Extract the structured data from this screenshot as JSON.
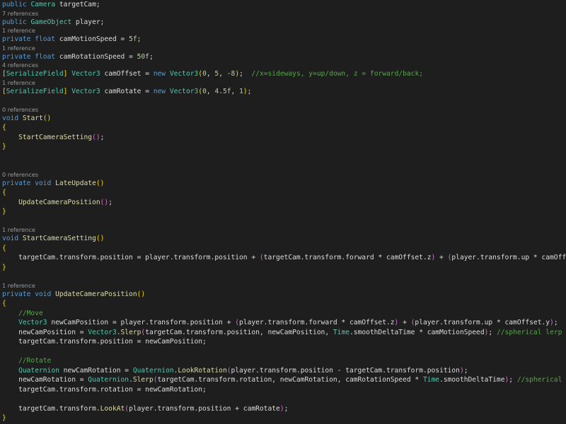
{
  "editor": {
    "language": "csharp",
    "colors": {
      "background": "#1e1e1e",
      "keyword": "#569cd6",
      "type": "#4ec9b0",
      "method": "#dcdcaa",
      "number": "#b5cea8",
      "comment": "#57a64a",
      "codelens": "#999999"
    },
    "lines": [
      {
        "kind": "code",
        "tokens": [
          {
            "t": "public ",
            "c": "kw"
          },
          {
            "t": "Camera ",
            "c": "type"
          },
          {
            "t": "targetCam;"
          }
        ]
      },
      {
        "kind": "lens",
        "text": "7 references"
      },
      {
        "kind": "code",
        "tokens": [
          {
            "t": "public ",
            "c": "kw"
          },
          {
            "t": "GameObject ",
            "c": "type"
          },
          {
            "t": "player;"
          }
        ]
      },
      {
        "kind": "lens",
        "text": "1 reference"
      },
      {
        "kind": "code",
        "tokens": [
          {
            "t": "private float ",
            "c": "kw"
          },
          {
            "t": "camMotionSpeed = "
          },
          {
            "t": "5f",
            "c": "num"
          },
          {
            "t": ";"
          }
        ]
      },
      {
        "kind": "lens",
        "text": "1 reference"
      },
      {
        "kind": "code",
        "tokens": [
          {
            "t": "private float ",
            "c": "kw"
          },
          {
            "t": "camRotationSpeed = "
          },
          {
            "t": "50f",
            "c": "num"
          },
          {
            "t": ";"
          }
        ]
      },
      {
        "kind": "lens",
        "text": "4 references"
      },
      {
        "kind": "code",
        "tokens": [
          {
            "t": "[",
            "c": "b1"
          },
          {
            "t": "SerializeField",
            "c": "attr"
          },
          {
            "t": "] ",
            "c": "b1"
          },
          {
            "t": "Vector3 ",
            "c": "type"
          },
          {
            "t": "camOffset = "
          },
          {
            "t": "new ",
            "c": "kw"
          },
          {
            "t": "Vector3",
            "c": "type"
          },
          {
            "t": "(",
            "c": "b1"
          },
          {
            "t": "0",
            "c": "num"
          },
          {
            "t": ", "
          },
          {
            "t": "5",
            "c": "num"
          },
          {
            "t": ", -"
          },
          {
            "t": "8",
            "c": "num"
          },
          {
            "t": ")",
            "c": "b1"
          },
          {
            "t": ";  "
          },
          {
            "t": "//x=sideways, y=up/down, z = forward/back;",
            "c": "cmt"
          }
        ]
      },
      {
        "kind": "lens",
        "text": "1 reference"
      },
      {
        "kind": "code",
        "tokens": [
          {
            "t": "[",
            "c": "b1"
          },
          {
            "t": "SerializeField",
            "c": "attr"
          },
          {
            "t": "] ",
            "c": "b1"
          },
          {
            "t": "Vector3 ",
            "c": "type"
          },
          {
            "t": "camRotate = "
          },
          {
            "t": "new ",
            "c": "kw"
          },
          {
            "t": "Vector3",
            "c": "type"
          },
          {
            "t": "(",
            "c": "b1"
          },
          {
            "t": "0",
            "c": "num"
          },
          {
            "t": ", "
          },
          {
            "t": "4.5f",
            "c": "num"
          },
          {
            "t": ", "
          },
          {
            "t": "1",
            "c": "num"
          },
          {
            "t": ")",
            "c": "b1"
          },
          {
            "t": ";"
          }
        ]
      },
      {
        "kind": "gap"
      },
      {
        "kind": "lens",
        "text": "0 references"
      },
      {
        "kind": "code",
        "tokens": [
          {
            "t": "void ",
            "c": "kw"
          },
          {
            "t": "Start",
            "c": "mth"
          },
          {
            "t": "()",
            "c": "b1"
          }
        ]
      },
      {
        "kind": "code",
        "tokens": [
          {
            "t": "{",
            "c": "b1"
          }
        ]
      },
      {
        "kind": "code",
        "tokens": [
          {
            "t": "    "
          },
          {
            "t": "StartCameraSetting",
            "c": "mth"
          },
          {
            "t": "()",
            "c": "b2"
          },
          {
            "t": ";"
          }
        ]
      },
      {
        "kind": "code",
        "tokens": [
          {
            "t": "}",
            "c": "b1"
          }
        ]
      },
      {
        "kind": "gap"
      },
      {
        "kind": "gap"
      },
      {
        "kind": "lens",
        "text": "0 references"
      },
      {
        "kind": "code",
        "tokens": [
          {
            "t": "private void ",
            "c": "kw"
          },
          {
            "t": "LateUpdate",
            "c": "mth"
          },
          {
            "t": "()",
            "c": "b1"
          }
        ]
      },
      {
        "kind": "code",
        "tokens": [
          {
            "t": "{",
            "c": "b1"
          }
        ]
      },
      {
        "kind": "code",
        "tokens": [
          {
            "t": "    "
          },
          {
            "t": "UpdateCameraPosition",
            "c": "mth"
          },
          {
            "t": "()",
            "c": "b2"
          },
          {
            "t": ";"
          }
        ]
      },
      {
        "kind": "code",
        "tokens": [
          {
            "t": "}",
            "c": "b1"
          }
        ]
      },
      {
        "kind": "gap"
      },
      {
        "kind": "lens",
        "text": "1 reference"
      },
      {
        "kind": "code",
        "tokens": [
          {
            "t": "void ",
            "c": "kw"
          },
          {
            "t": "StartCameraSetting",
            "c": "mth"
          },
          {
            "t": "()",
            "c": "b1"
          }
        ]
      },
      {
        "kind": "code",
        "tokens": [
          {
            "t": "{",
            "c": "b1"
          }
        ]
      },
      {
        "kind": "code",
        "tokens": [
          {
            "t": "    targetCam.transform.position = player.transform.position + "
          },
          {
            "t": "(",
            "c": "b2"
          },
          {
            "t": "targetCam.transform.forward * camOffset.z"
          },
          {
            "t": ")",
            "c": "b2"
          },
          {
            "t": " + "
          },
          {
            "t": "(",
            "c": "b2"
          },
          {
            "t": "player.transform.up * camOffset.y"
          },
          {
            "t": ")",
            "c": "b2"
          },
          {
            "t": ";"
          }
        ]
      },
      {
        "kind": "code",
        "tokens": [
          {
            "t": "}",
            "c": "b1"
          }
        ]
      },
      {
        "kind": "gap"
      },
      {
        "kind": "lens",
        "text": "1 reference"
      },
      {
        "kind": "code",
        "tokens": [
          {
            "t": "private void ",
            "c": "kw"
          },
          {
            "t": "UpdateCameraPosition",
            "c": "mth"
          },
          {
            "t": "()",
            "c": "b1"
          }
        ]
      },
      {
        "kind": "code",
        "tokens": [
          {
            "t": "{",
            "c": "b1"
          }
        ]
      },
      {
        "kind": "code",
        "tokens": [
          {
            "t": "    "
          },
          {
            "t": "//Move",
            "c": "cmt"
          }
        ]
      },
      {
        "kind": "code",
        "tokens": [
          {
            "t": "    "
          },
          {
            "t": "Vector3 ",
            "c": "type"
          },
          {
            "t": "newCamPosition = player.transform.position + "
          },
          {
            "t": "(",
            "c": "b2"
          },
          {
            "t": "player.transform.forward * camOffset.z"
          },
          {
            "t": ")",
            "c": "b2"
          },
          {
            "t": " + "
          },
          {
            "t": "(",
            "c": "b2"
          },
          {
            "t": "player.transform.up * camOffset.y"
          },
          {
            "t": ")",
            "c": "b2"
          },
          {
            "t": ";"
          }
        ]
      },
      {
        "kind": "code",
        "tokens": [
          {
            "t": "    newCamPosition = "
          },
          {
            "t": "Vector3",
            "c": "type"
          },
          {
            "t": "."
          },
          {
            "t": "Slerp",
            "c": "mth"
          },
          {
            "t": "(",
            "c": "b2"
          },
          {
            "t": "targetCam.transform.position, newCamPosition, "
          },
          {
            "t": "Time",
            "c": "type"
          },
          {
            "t": ".smoothDeltaTime * camMotionSpeed"
          },
          {
            "t": ")",
            "c": "b2"
          },
          {
            "t": "; "
          },
          {
            "t": "//spherical lerp smoothin",
            "c": "cmt"
          }
        ]
      },
      {
        "kind": "code",
        "tokens": [
          {
            "t": "    targetCam.transform.position = newCamPosition;"
          }
        ]
      },
      {
        "kind": "gap"
      },
      {
        "kind": "code",
        "tokens": [
          {
            "t": "    "
          },
          {
            "t": "//Rotate",
            "c": "cmt"
          }
        ]
      },
      {
        "kind": "code",
        "tokens": [
          {
            "t": "    "
          },
          {
            "t": "Quaternion ",
            "c": "type"
          },
          {
            "t": "newCamRotation = "
          },
          {
            "t": "Quaternion",
            "c": "type"
          },
          {
            "t": "."
          },
          {
            "t": "LookRotation",
            "c": "mth"
          },
          {
            "t": "(",
            "c": "b2"
          },
          {
            "t": "player.transform.position - targetCam.transform.position"
          },
          {
            "t": ")",
            "c": "b2"
          },
          {
            "t": ";"
          }
        ]
      },
      {
        "kind": "code",
        "tokens": [
          {
            "t": "    newCamRotation = "
          },
          {
            "t": "Quaternion",
            "c": "type"
          },
          {
            "t": "."
          },
          {
            "t": "Slerp",
            "c": "mth"
          },
          {
            "t": "(",
            "c": "b2"
          },
          {
            "t": "targetCam.transform.rotation, newCamRotation, camRotationSpeed * "
          },
          {
            "t": "Time",
            "c": "type"
          },
          {
            "t": ".smoothDeltaTime"
          },
          {
            "t": ")",
            "c": "b2"
          },
          {
            "t": "; "
          },
          {
            "t": "//spherical lerp smo",
            "c": "cmt"
          }
        ]
      },
      {
        "kind": "code",
        "tokens": [
          {
            "t": "    targetCam.transform.rotation = newCamRotation;"
          }
        ]
      },
      {
        "kind": "gap"
      },
      {
        "kind": "code",
        "tokens": [
          {
            "t": "    targetCam.transform."
          },
          {
            "t": "LookAt",
            "c": "mth"
          },
          {
            "t": "(",
            "c": "b2"
          },
          {
            "t": "player.transform.position + camRotate"
          },
          {
            "t": ")",
            "c": "b2"
          },
          {
            "t": ";"
          }
        ]
      },
      {
        "kind": "code",
        "tokens": [
          {
            "t": "}",
            "c": "b1"
          }
        ]
      }
    ]
  }
}
